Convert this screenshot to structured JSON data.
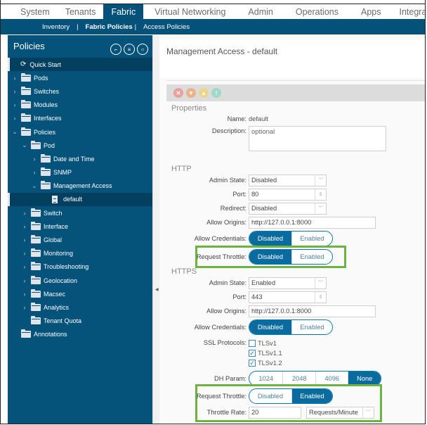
{
  "topnav": {
    "tabs": [
      {
        "label": "System",
        "active": false
      },
      {
        "label": "Tenants",
        "active": false
      },
      {
        "label": "Fabric",
        "active": true
      },
      {
        "label": "Virtual Networking",
        "active": false
      },
      {
        "label": "Admin",
        "active": false
      },
      {
        "label": "Operations",
        "active": false
      },
      {
        "label": "Apps",
        "active": false
      },
      {
        "label": "Integrations",
        "active": false
      }
    ]
  },
  "subnav": {
    "items": [
      {
        "label": "Inventory",
        "active": false
      },
      {
        "label": "Fabric Policies",
        "active": true
      },
      {
        "label": "Access Policies",
        "active": false
      }
    ],
    "separator": "|"
  },
  "sidebar": {
    "title": "Policies",
    "header_icons": [
      "quick-start-icon",
      "filter-list-icon",
      "refresh-icon"
    ],
    "tree": {
      "quick_start": "Quick Start",
      "pods": "Pods",
      "switches": "Switches",
      "modules": "Modules",
      "interfaces": "Interfaces",
      "policies": "Policies",
      "pod": "Pod",
      "date_and_time": "Date and Time",
      "snmp": "SNMP",
      "management_access": "Management Access",
      "default": "default",
      "switch": "Switch",
      "interface": "Interface",
      "global": "Global",
      "monitoring": "Monitoring",
      "troubleshooting": "Troubleshooting",
      "geolocation": "Geolocation",
      "macsec": "Macsec",
      "analytics": "Analytics",
      "tenant_quota": "Tenant Quota",
      "annotations": "Annotations"
    },
    "selected": "default"
  },
  "content": {
    "title": "Management Access - default",
    "fault_icons": [
      {
        "name": "critical-fault-icon",
        "glyph": "✕",
        "color": "#e8a19c"
      },
      {
        "name": "major-fault-icon",
        "glyph": "▼",
        "color": "#eab38a"
      },
      {
        "name": "minor-fault-icon",
        "glyph": "▲",
        "color": "#eed58c"
      },
      {
        "name": "warning-fault-icon",
        "glyph": "!",
        "color": "#9fd8c8"
      }
    ],
    "properties": {
      "heading": "Properties",
      "name_label": "Name:",
      "name_value": "default",
      "description_label": "Description:",
      "description_placeholder": "optional"
    },
    "http": {
      "heading": "HTTP",
      "admin_state_label": "Admin State:",
      "admin_state_value": "Disabled",
      "port_label": "Port:",
      "port_value": "80",
      "redirect_label": "Redirect:",
      "redirect_value": "Disabled",
      "allow_origins_label": "Allow Origins:",
      "allow_origins_value": "http://127.0.0.1:8000",
      "allow_credentials_label": "Allow Credentials:",
      "allow_credentials_options": [
        "Disabled",
        "Enabled"
      ],
      "allow_credentials_selected": "Disabled",
      "request_throttle_label": "Request Throttle:",
      "request_throttle_options": [
        "Disabled",
        "Enabled"
      ],
      "request_throttle_selected": "Disabled"
    },
    "https": {
      "heading": "HTTPS",
      "admin_state_label": "Admin State:",
      "admin_state_value": "Enabled",
      "port_label": "Port:",
      "port_value": "443",
      "allow_origins_label": "Allow Origins:",
      "allow_origins_value": "http://127.0.0.1:8000",
      "allow_credentials_label": "Allow Credentials:",
      "allow_credentials_options": [
        "Disabled",
        "Enabled"
      ],
      "allow_credentials_selected": "Disabled",
      "ssl_protocols_label": "SSL Protocols:",
      "ssl_protocols": [
        {
          "label": "TLSv1",
          "checked": false
        },
        {
          "label": "TLSv1.1",
          "checked": true
        },
        {
          "label": "TLSv1.2",
          "checked": true
        }
      ],
      "dh_param_label": "DH Param:",
      "dh_param_options": [
        "1024",
        "2048",
        "4096",
        "None"
      ],
      "dh_param_selected": "None",
      "request_throttle_label": "Request Throttle:",
      "request_throttle_options": [
        "Disabled",
        "Enabled"
      ],
      "request_throttle_selected": "Enabled",
      "throttle_rate_label": "Throttle Rate:",
      "throttle_rate_value": "20",
      "throttle_rate_unit": "Requests/Minute"
    },
    "highlight_color": "#6db33f",
    "accent_color": "#0a6b9e"
  }
}
